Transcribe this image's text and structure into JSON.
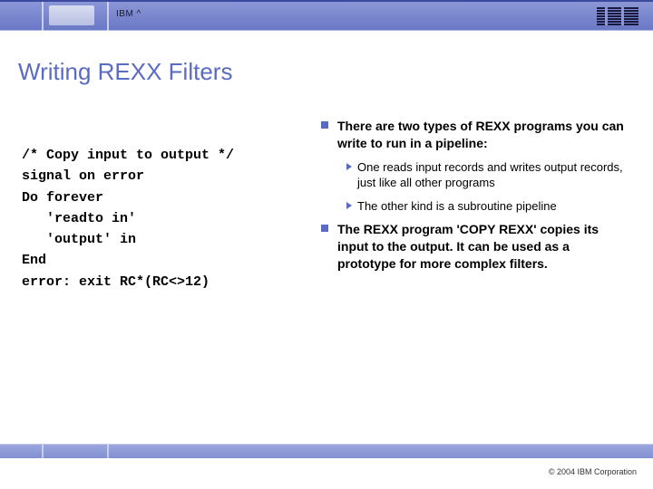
{
  "header": {
    "brand_text": "IBM ^"
  },
  "title": "Writing REXX Filters",
  "code": "/* Copy input to output */\nsignal on error\nDo forever\n   'readto in'\n   'output' in\nEnd\nerror: exit RC*(RC<>12)",
  "bullets": {
    "b1": "There are two types of REXX programs you can write to run in a pipeline:",
    "b1a": "One reads input records and writes output records, just like all other programs",
    "b1b": "The other kind is a subroutine pipeline",
    "b2": "The REXX program 'COPY REXX' copies its input to the output.  It can be used as a prototype for more complex filters."
  },
  "footer": {
    "copyright": "© 2004 IBM Corporation"
  }
}
